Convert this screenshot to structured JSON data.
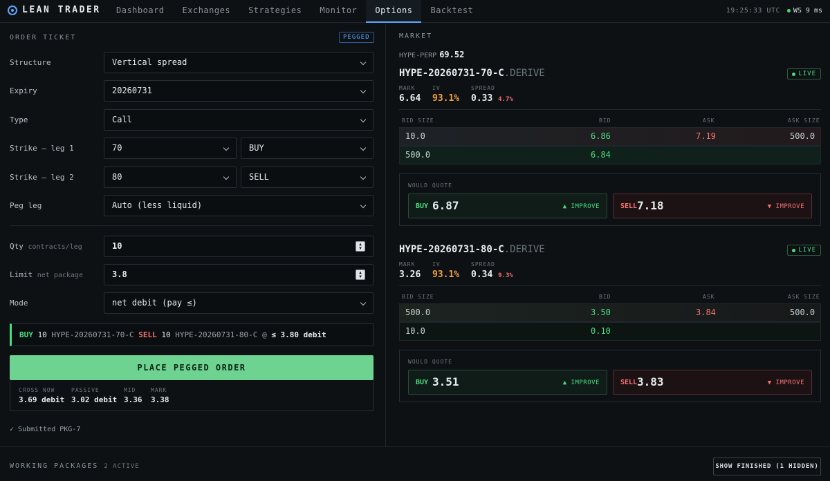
{
  "app": {
    "name": "LEAN TRADER",
    "nav": [
      "Dashboard",
      "Exchanges",
      "Strategies",
      "Monitor",
      "Options",
      "Backtest"
    ],
    "active_tab": "Options",
    "clock": "19:25:33 UTC",
    "ws_status": "WS 9 ms"
  },
  "ticket": {
    "title": "ORDER TICKET",
    "badge": "PEGGED",
    "structure_label": "Structure",
    "structure_value": "Vertical spread",
    "expiry_label": "Expiry",
    "expiry_value": "20260731",
    "type_label": "Type",
    "type_value": "Call",
    "leg1_label": "Strike — leg 1",
    "leg1_strike": "70",
    "leg1_side": "BUY",
    "leg2_label": "Strike — leg 2",
    "leg2_strike": "80",
    "leg2_side": "SELL",
    "peg_label": "Peg leg",
    "peg_value": "Auto (less liquid)",
    "qty_label": "Qty",
    "qty_sub": "contracts/leg",
    "qty_value": "10",
    "limit_label": "Limit",
    "limit_sub": "net package",
    "limit_value": "3.8",
    "mode_label": "Mode",
    "mode_value": "net debit (pay ≤)",
    "summary": {
      "buy": "BUY",
      "buy_qty": "10",
      "buy_inst": "HYPE-20260731-70-C",
      "sell": "SELL",
      "sell_qty": "10",
      "sell_inst": "HYPE-20260731-80-C",
      "at": "@",
      "price": "≤ 3.80 debit"
    },
    "place_button": "PLACE PEGGED ORDER",
    "quotes": [
      {
        "label": "CROSS NOW",
        "value": "3.69 debit"
      },
      {
        "label": "PASSIVE",
        "value": "3.02 debit"
      },
      {
        "label": "MID",
        "value": "3.36"
      },
      {
        "label": "MARK",
        "value": "3.38"
      }
    ],
    "submitted": "✓ Submitted PKG-7"
  },
  "market": {
    "title": "MARKET",
    "perp_name": "HYPE-PERP",
    "perp_price": "69.52",
    "book_headers": [
      "BID SIZE",
      "BID",
      "ASK",
      "ASK SIZE"
    ],
    "would_quote": "WOULD QUOTE",
    "instruments": [
      {
        "name": "HYPE-20260731-70-C",
        "venue": ".DERIVE",
        "status": "LIVE",
        "mark_label": "MARK",
        "mark": "6.64",
        "iv_label": "IV",
        "iv": "93.1%",
        "spread_label": "SPREAD",
        "spread": "0.33",
        "spread_pct": "4.7%",
        "rows": [
          {
            "bid_size": "10.0",
            "bid": "6.86",
            "ask": "7.19",
            "ask_size": "500.0"
          },
          {
            "bid_size": "500.0",
            "bid": "6.84",
            "ask": "",
            "ask_size": ""
          }
        ],
        "buy_label": "BUY",
        "buy_price": "6.87",
        "buy_improve": "▲ IMPROVE",
        "sell_label": "SELL",
        "sell_price": "7.18",
        "sell_improve": "▼ IMPROVE"
      },
      {
        "name": "HYPE-20260731-80-C",
        "venue": ".DERIVE",
        "status": "LIVE",
        "mark_label": "MARK",
        "mark": "3.26",
        "iv_label": "IV",
        "iv": "93.1%",
        "spread_label": "SPREAD",
        "spread": "0.34",
        "spread_pct": "9.3%",
        "rows": [
          {
            "bid_size": "500.0",
            "bid": "3.50",
            "ask": "3.84",
            "ask_size": "500.0"
          },
          {
            "bid_size": "10.0",
            "bid": "0.10",
            "ask": "",
            "ask_size": ""
          }
        ],
        "buy_label": "BUY",
        "buy_price": "3.51",
        "buy_improve": "▲ IMPROVE",
        "sell_label": "SELL",
        "sell_price": "3.83",
        "sell_improve": "▼ IMPROVE"
      }
    ]
  },
  "working": {
    "title": "WORKING PACKAGES",
    "count": "2 ACTIVE",
    "show_button": "SHOW FINISHED (1 HIDDEN)"
  },
  "colors": {
    "accent": "#5fa8ff",
    "bid": "#4ade80",
    "ask": "#f87171",
    "iv": "#f5a142",
    "place_button": "#6ed391"
  }
}
